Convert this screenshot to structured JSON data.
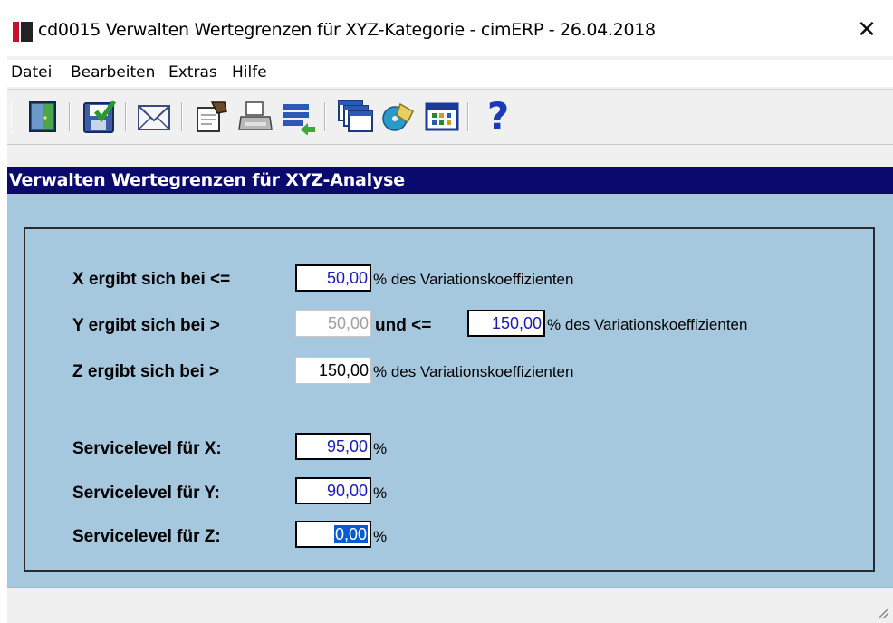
{
  "window": {
    "title": "cd0015 Verwalten Wertegrenzen für XYZ-Kategorie - cimERP - 26.04.2018",
    "close_glyph": "✕"
  },
  "menu": {
    "items": [
      "Datei",
      "Bearbeiten",
      "Extras",
      "Hilfe"
    ]
  },
  "toolbar": {
    "icons": [
      "exit-door-icon",
      "save-check-icon",
      "envelope-icon",
      "notepad-hand-icon",
      "printer-icon",
      "transfer-list-icon",
      "windows-stack-icon",
      "cd-tag-icon",
      "grid-table-icon",
      "help-question-icon"
    ],
    "help_glyph": "?"
  },
  "header": {
    "title": "Verwalten Wertegrenzen für XYZ-Analyse"
  },
  "form": {
    "x_label": "X ergibt sich bei <=",
    "x_value": "50,00",
    "x_unit": "% des Variationskoeffizienten",
    "y_label": "Y ergibt sich bei >",
    "y_lower": "50,00",
    "y_and": "und <=",
    "y_upper": "150,00",
    "y_unit": "% des Variationskoeffizienten",
    "z_label": "Z ergibt sich bei >",
    "z_value": "150,00",
    "z_unit": "% des Variationskoeffizienten",
    "sl_x_label": "Servicelevel für X:",
    "sl_x_value": "95,00",
    "sl_y_label": "Servicelevel für Y:",
    "sl_y_value": "90,00",
    "sl_z_label": "Servicelevel für Z:",
    "sl_z_value": "0,00",
    "percent": "%"
  },
  "colors": {
    "header_band": "#0a0a6e",
    "content_bg": "#a6c8de",
    "field_text_blue": "#1a1ab4",
    "selection": "#0a5ad2"
  }
}
